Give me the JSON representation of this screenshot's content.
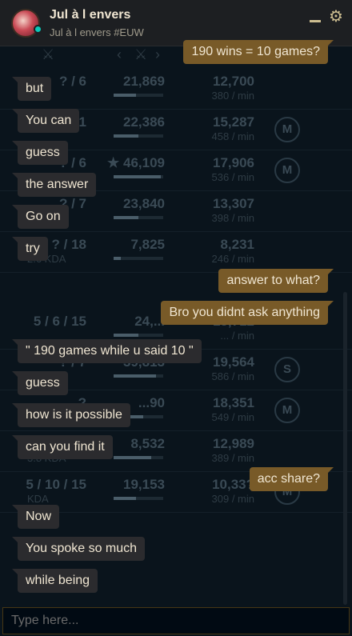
{
  "header": {
    "title": "Jul à l envers",
    "subtitle": "Jul à l envers #EUW"
  },
  "background_stats": [
    {
      "kills": "? / 6",
      "kda": "KDA",
      "damage": "21,869",
      "damage_fill": 0.45,
      "gold": "12,700",
      "gpm": "380 / min",
      "medal": ""
    },
    {
      "kills": "1 / 1",
      "kda": "",
      "damage": "22,386",
      "damage_fill": 0.5,
      "gold": "15,287",
      "gpm": "458 / min",
      "medal": "M"
    },
    {
      "kills": "? / 6",
      "kda": "",
      "damage": "★ 46,109",
      "damage_fill": 0.95,
      "gold": "17,906",
      "gpm": "536 / min",
      "medal": "M"
    },
    {
      "kills": "? / 7",
      "kda": "",
      "damage": "23,840",
      "damage_fill": 0.5,
      "gold": "13,307",
      "gpm": "398 / min",
      "medal": ""
    },
    {
      "kills": "? / 18",
      "kda": "2.6 KDA",
      "damage": "7,825",
      "damage_fill": 0.15,
      "gold": "8,231",
      "gpm": "246 / min",
      "medal": ""
    },
    {
      "kills": "5 / 6 / 15",
      "kda": "",
      "damage": "24,...",
      "damage_fill": 0.5,
      "gold": "15,712",
      "gpm": "... / min",
      "medal": ""
    },
    {
      "kills": "? / 7",
      "kda": "",
      "damage": "39,813",
      "damage_fill": 0.85,
      "gold": "19,564",
      "gpm": "586 / min",
      "medal": "S"
    },
    {
      "kills": "?",
      "kda": "",
      "damage": "...90",
      "damage_fill": 0.6,
      "gold": "18,351",
      "gpm": "549 / min",
      "medal": "M"
    },
    {
      "kills": "?",
      "kda": "3.8 KDA",
      "damage": "8,532",
      "damage_fill": 0.75,
      "gold": "12,989",
      "gpm": "389 / min",
      "medal": ""
    },
    {
      "kills": "5 / 10 / 15",
      "kda": "KDA",
      "damage": "19,153",
      "damage_fill": 0.45,
      "gold": "10,33?",
      "gpm": "309 / min",
      "medal": "M"
    }
  ],
  "messages": [
    {
      "text": "190 wins = 10 games?",
      "direction": "out"
    },
    {
      "text": "but",
      "direction": "in"
    },
    {
      "text": "You can",
      "direction": "in"
    },
    {
      "text": "guess",
      "direction": "in"
    },
    {
      "text": "the answer",
      "direction": "in"
    },
    {
      "text": "Go on",
      "direction": "in"
    },
    {
      "text": "try",
      "direction": "in"
    },
    {
      "text": "answer to what?",
      "direction": "out"
    },
    {
      "text": "Bro you didnt ask anything",
      "direction": "out"
    },
    {
      "text": "\" 190 games while u said 10 \"",
      "direction": "in"
    },
    {
      "text": "guess",
      "direction": "in"
    },
    {
      "text": "how is it possible",
      "direction": "in"
    },
    {
      "text": "can you find it",
      "direction": "in"
    },
    {
      "text": "acc share?",
      "direction": "out"
    },
    {
      "text": "Now",
      "direction": "in"
    },
    {
      "text": "You spoke so much",
      "direction": "in"
    },
    {
      "text": "while being",
      "direction": "in"
    }
  ],
  "input": {
    "placeholder": "Type here..."
  },
  "icons": {
    "minimize": "minimize-icon",
    "settings": "gear-icon",
    "online_status": "online-status-dot"
  },
  "colors": {
    "outgoing_bubble": "#785a28",
    "incoming_bubble": "#2b2b2e",
    "status_online": "#0ac8b9",
    "gold_accent": "#cdbe91"
  }
}
